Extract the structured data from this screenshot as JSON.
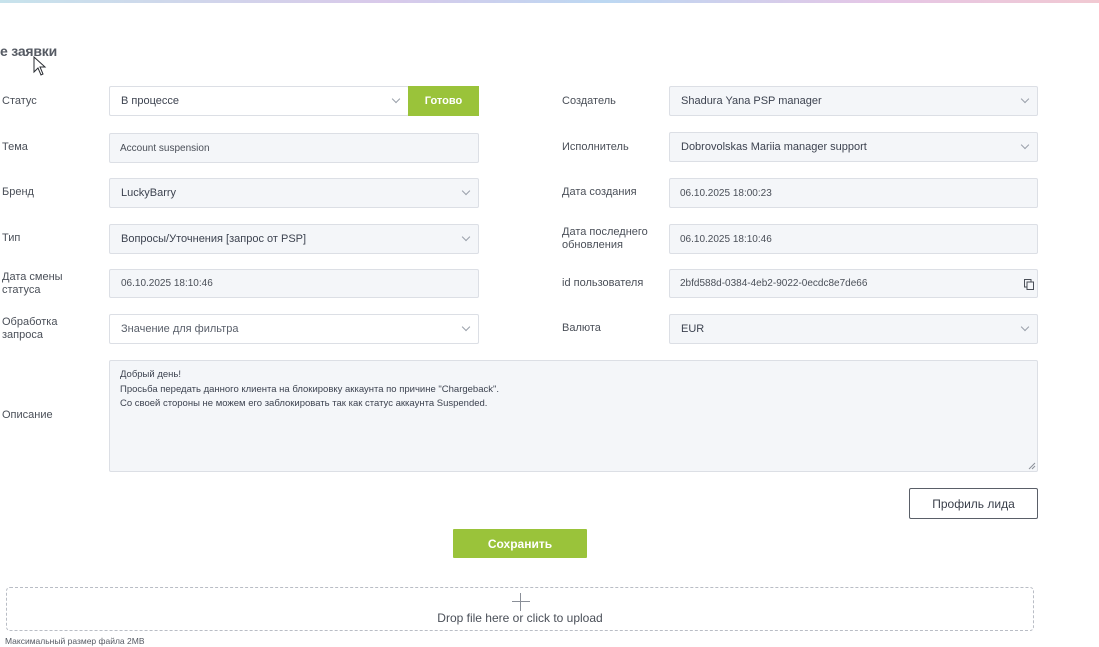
{
  "page": {
    "title": "е заявки"
  },
  "form": {
    "status": {
      "label": "Статус",
      "value": "В процессе",
      "done_button": "Готово"
    },
    "topic": {
      "label": "Тема",
      "value": "Account suspension"
    },
    "brand": {
      "label": "Бренд",
      "value": "LuckyBarry"
    },
    "type": {
      "label": "Тип",
      "value": "Вопросы/Уточнения [запрос от PSP]"
    },
    "status_change_date": {
      "label_line1": "Дата смены",
      "label_line2": "статуса",
      "value": "06.10.2025 18:10:46"
    },
    "request_processing": {
      "label_line1": "Обработка",
      "label_line2": "запроса",
      "placeholder": "Значение для фильтра"
    },
    "creator": {
      "label": "Создатель",
      "value": "Shadura Yana PSP manager"
    },
    "assignee": {
      "label": "Исполнитель",
      "value": "Dobrovolskas Mariia manager support"
    },
    "created_date": {
      "label": "Дата создания",
      "value": "06.10.2025 18:00:23"
    },
    "last_update": {
      "label_line1": "Дата последнего",
      "label_line2": "обновления",
      "value": "06.10.2025 18:10:46"
    },
    "user_id": {
      "label": "id пользователя",
      "value": "2bfd588d-0384-4eb2-9022-0ecdc8e7de66"
    },
    "currency": {
      "label": "Валюта",
      "value": "EUR"
    },
    "description": {
      "label": "Описание",
      "lines": [
        "Добрый день!",
        "Просьба передать данного клиента на блокировку аккаунта по причине \"Chargeback\".",
        "Со своей стороны не можем его заблокировать так как статус аккаунта Suspended."
      ]
    }
  },
  "actions": {
    "lead_profile": "Профиль лида",
    "save": "Сохранить"
  },
  "upload": {
    "drop_text": "Drop file here or click to upload",
    "max_size": "Максимальный размер файла 2MB"
  },
  "colors": {
    "accent_green": "#9ac33a",
    "field_bg": "#f4f6f9",
    "border": "#dcdfe5"
  },
  "icons": [
    "cursor-icon",
    "chevron-down-icon",
    "copy-icon",
    "resize-handle-icon",
    "plus-icon"
  ]
}
